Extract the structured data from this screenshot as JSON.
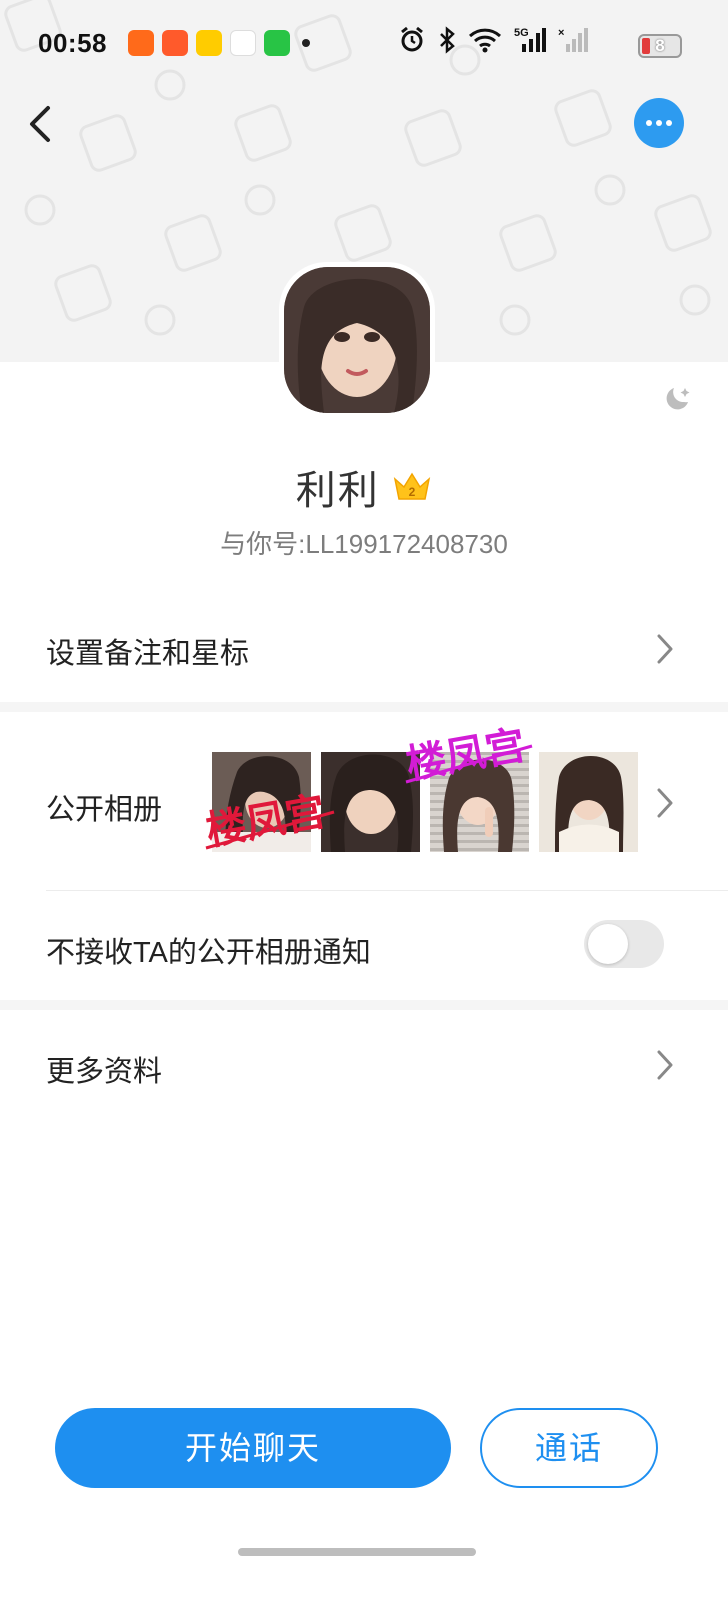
{
  "status_bar": {
    "time": "00:58",
    "notification_icons": [
      "taobao-icon",
      "app-icon",
      "qimao-icon",
      "sohu-news-icon",
      "wechat-mini-icon"
    ],
    "system_icons": [
      "alarm-icon",
      "bluetooth-icon",
      "wifi-icon",
      "signal-5g-icon",
      "signal-no-sim-icon"
    ],
    "battery_level": "8"
  },
  "header": {
    "back_icon": "chevron-left-icon",
    "more_icon": "more-dots-icon"
  },
  "profile": {
    "name": "利利",
    "badge_level": "2",
    "uid_text": "与你号:LL199172408730"
  },
  "rows": {
    "remark_label": "设置备注和星标",
    "album_label": "公开相册",
    "album_watermark": "楼凤宫",
    "notify_label": "不接收TA的公开相册通知",
    "notify_enabled": false,
    "more_info_label": "更多资料"
  },
  "actions": {
    "chat_label": "开始聊天",
    "call_label": "通话"
  },
  "colors": {
    "accent": "#1e8ff0",
    "header_bg": "#f3f3f3",
    "watermark_red": "#e0183a",
    "watermark_magenta": "#d21cd6"
  }
}
